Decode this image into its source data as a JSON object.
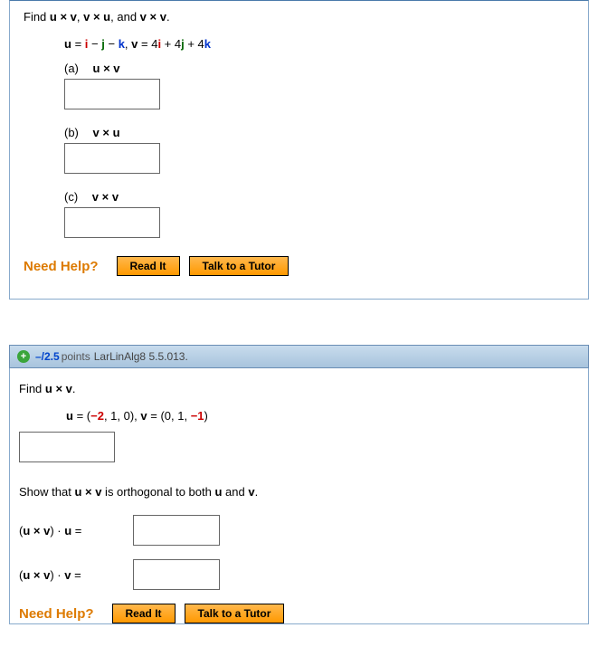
{
  "q1": {
    "prompt_pre": "Find ",
    "prompt_uv": "u × v",
    "prompt_sep1": ", ",
    "prompt_vu": "v × u",
    "prompt_sep2": ", and ",
    "prompt_vv": "v × v",
    "prompt_post": ".",
    "u_eq": "u",
    "eq": " = ",
    "u_i": "i",
    "u_m1": " − ",
    "u_j": "j",
    "u_m2": " − ",
    "u_k": "k",
    "vsep": ",    ",
    "v_eq": "v",
    "v4i": " = 4",
    "v_i": "i",
    "v_p1": " + 4",
    "v_j": "j",
    "v_p2": " + 4",
    "v_k": "k",
    "parts": {
      "a": {
        "label": "(a)",
        "expr_l": "u",
        "cross": " × ",
        "expr_r": "v"
      },
      "b": {
        "label": "(b)",
        "expr_l": "v",
        "cross": " × ",
        "expr_r": "u"
      },
      "c": {
        "label": "(c)",
        "expr_l": "v",
        "cross": " × ",
        "expr_r": "v"
      }
    }
  },
  "q2": {
    "header": {
      "score": "–/2.5",
      "points": " points",
      "ref": "LarLinAlg8 5.5.013."
    },
    "prompt1_pre": "Find ",
    "prompt1_uv": "u × v",
    "prompt1_post": ".",
    "u_lbl": "u",
    "u_eq": " = (",
    "u_n2": "−2",
    "u_rest": ", 1, 0),    ",
    "v_lbl": "v",
    "v_eq": " = (0, 1, ",
    "v_n1": "−1",
    "v_close": ")",
    "prompt2_pre": "Show that ",
    "prompt2_uv": "u × v",
    "prompt2_mid": " is orthogonal to both ",
    "prompt2_u": "u",
    "prompt2_and": " and ",
    "prompt2_v": "v",
    "prompt2_post": ".",
    "dot1_pre": "(",
    "dot1_uv": "u × v",
    "dot1_mid": ")  ·  ",
    "dot1_u": "u",
    "dot1_eq": "  =  ",
    "dot2_pre": "(",
    "dot2_uv": "u × v",
    "dot2_mid": ")  ·  ",
    "dot2_v": "v",
    "dot2_eq": "  =  "
  },
  "help": {
    "label": "Need Help?",
    "readit": "Read It",
    "tutor": "Talk to a Tutor"
  }
}
